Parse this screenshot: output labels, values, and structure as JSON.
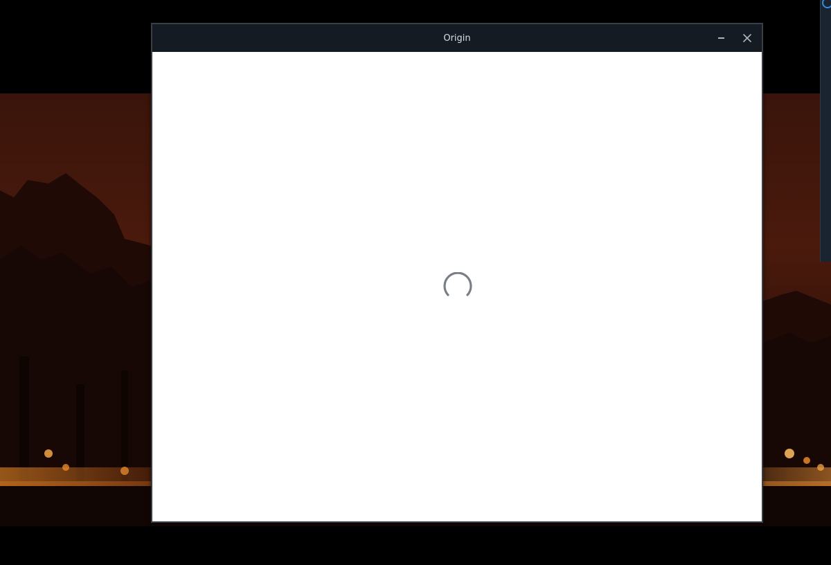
{
  "window": {
    "title": "Origin",
    "controls": {
      "minimize_icon": "minimize-icon",
      "close_icon": "close-icon"
    }
  },
  "content": {
    "state": "loading",
    "spinner_icon": "loading-spinner-icon"
  },
  "colors": {
    "titlebar_bg": "#151b22",
    "content_bg": "#ffffff",
    "spinner": "#7a7f85",
    "accent_blue": "#2f8fe0"
  }
}
